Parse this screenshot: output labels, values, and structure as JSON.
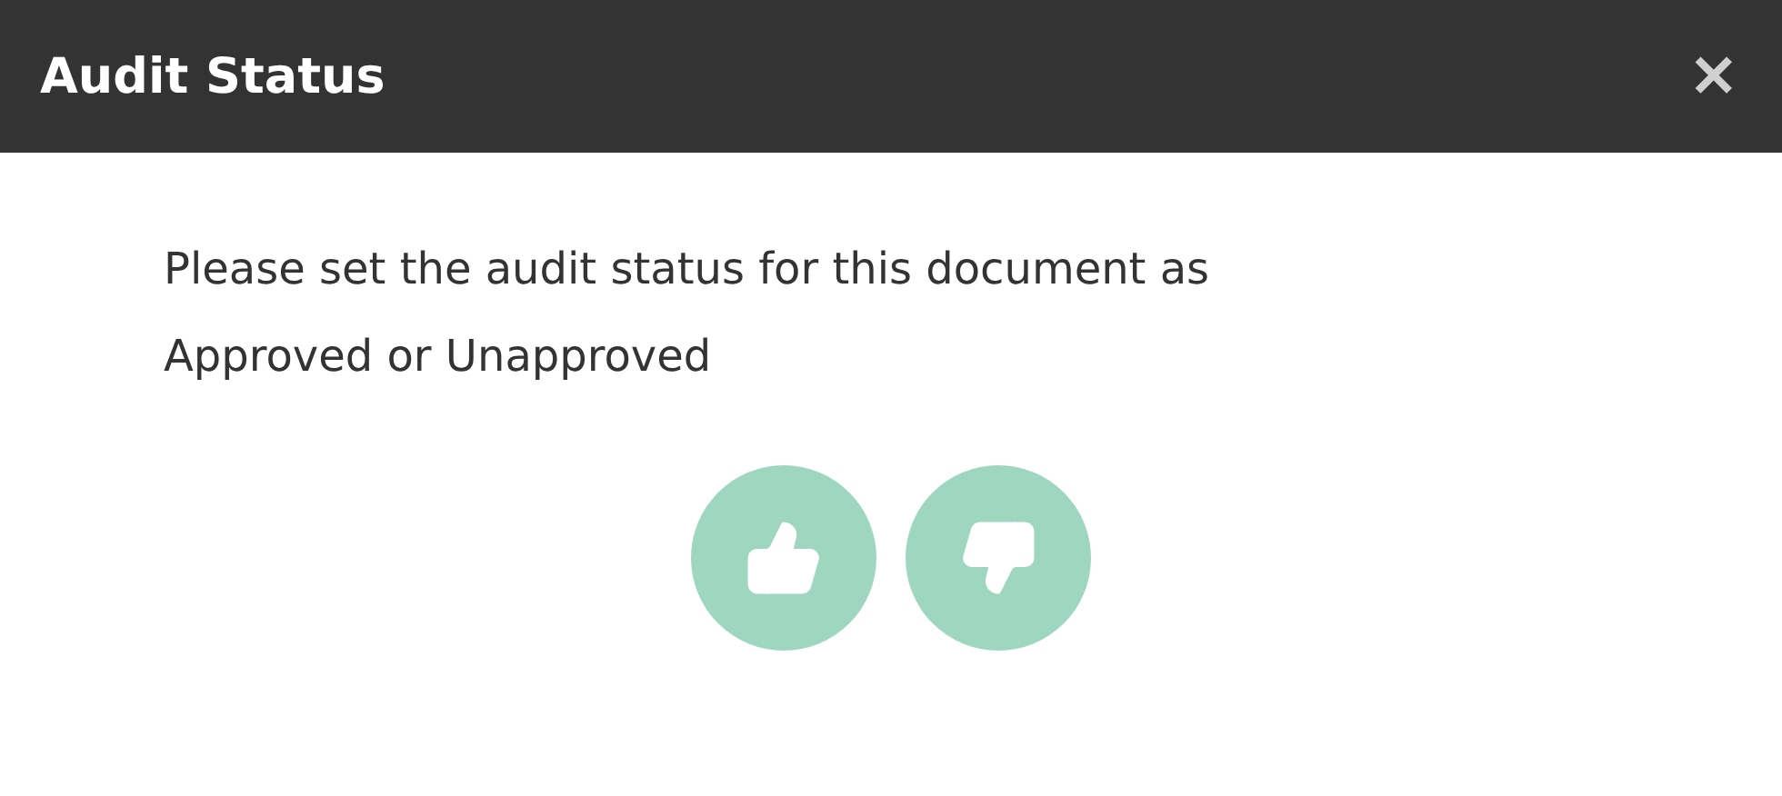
{
  "dialog": {
    "title": "Audit Status",
    "close_label": "✕",
    "message": "Please set the audit status for this document as\nApproved or Unapproved",
    "actions": [
      {
        "kind": "approve"
      },
      {
        "kind": "reject"
      }
    ]
  }
}
